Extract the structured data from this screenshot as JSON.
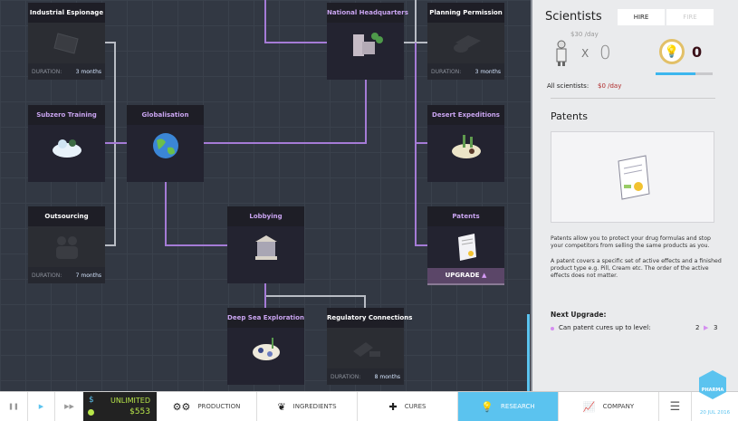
{
  "tree": {
    "cards": [
      {
        "id": "industrial-espionage",
        "title": "Industrial Espionage",
        "locked": true,
        "duration_label": "DURATION:",
        "duration": "3 months",
        "icon": "laptop-icon"
      },
      {
        "id": "subzero-training",
        "title": "Subzero Training",
        "locked": false,
        "icon": "snow-base-icon"
      },
      {
        "id": "globalisation",
        "title": "Globalisation",
        "locked": false,
        "icon": "globe-icon"
      },
      {
        "id": "outsourcing",
        "title": "Outsourcing",
        "locked": true,
        "duration_label": "DURATION:",
        "duration": "7 months",
        "icon": "people-icon"
      },
      {
        "id": "lobbying",
        "title": "Lobbying",
        "locked": false,
        "icon": "government-building-icon"
      },
      {
        "id": "national-headquarters",
        "title": "National Headquarters",
        "locked": false,
        "icon": "office-building-icon"
      },
      {
        "id": "planning-permission",
        "title": "Planning Permission",
        "locked": true,
        "duration_label": "DURATION:",
        "duration": "3 months",
        "icon": "blueprint-icon"
      },
      {
        "id": "desert-expeditions",
        "title": "Desert Expeditions",
        "locked": false,
        "icon": "desert-base-icon"
      },
      {
        "id": "patents",
        "title": "Patents",
        "locked": false,
        "icon": "certificate-icon"
      },
      {
        "id": "deep-sea-exploration",
        "title": "Deep Sea Exploration",
        "locked": false,
        "icon": "sea-base-icon"
      },
      {
        "id": "regulatory-connections",
        "title": "Regulatory Connections",
        "locked": true,
        "duration_label": "DURATION:",
        "duration": "8 months",
        "icon": "documents-icon"
      }
    ],
    "upgrade_label": "UPGRADE",
    "upgrade_icon": "▲"
  },
  "panel": {
    "scientists_title": "Scientists",
    "hire": "HIRE",
    "fire": "FIRE",
    "cost": "$30 /day",
    "times": "X",
    "count": "0",
    "research_points": "0",
    "research_progress": 0.7,
    "all_label": "All scientists:",
    "all_value": "$0 /day",
    "section_title": "Patents",
    "desc1": "Patents allow you to protect your drug formulas and stop your competitors from selling the same products as you.",
    "desc2": "A patent covers a specific set of active effects and a finished product type e.g. Pill, Cream etc. The order of the active effects does not matter.",
    "next_title": "Next Upgrade:",
    "next_item": "Can patent cures up to level:",
    "level_from": "2",
    "level_to": "3"
  },
  "bottom": {
    "money_symbol": "$",
    "money_label": "UNLIMITED",
    "cash": "$553",
    "tabs": [
      {
        "label": "PRODUCTION",
        "icon": "gears-icon",
        "glyph": "⚙⚙"
      },
      {
        "label": "INGREDIENTS",
        "icon": "leaf-icon",
        "glyph": "❦"
      },
      {
        "label": "CURES",
        "icon": "cross-icon",
        "glyph": "✚"
      },
      {
        "label": "RESEARCH",
        "icon": "lightbulb-icon",
        "glyph": "💡"
      },
      {
        "label": "COMPANY",
        "icon": "chart-icon",
        "glyph": "📈"
      }
    ],
    "logo": "PHARMA",
    "date": "20 JUL 2016",
    "accent": "#5bc3ef"
  }
}
